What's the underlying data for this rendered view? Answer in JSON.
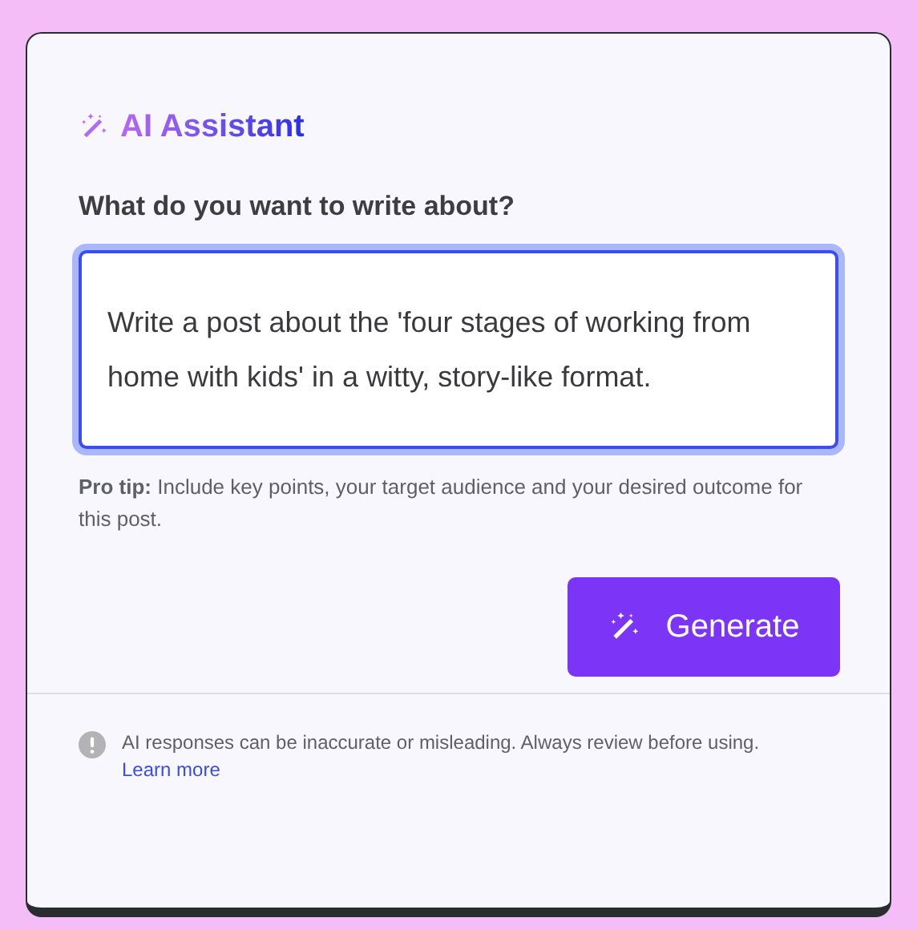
{
  "title": "AI Assistant",
  "prompt": {
    "label": "What do you want to write about?",
    "value": "Write a post about the 'four stages of working from home with kids' in a witty, story-like format.",
    "focused": true
  },
  "tip": "**Pro tip:** Include key points, your target audience and your desired outcome for this post.",
  "generate_button": "Generate",
  "disclaimer": {
    "text": "AI responses can be inaccurate or misleading. Always review before using.",
    "link": "Learn more"
  }
}
